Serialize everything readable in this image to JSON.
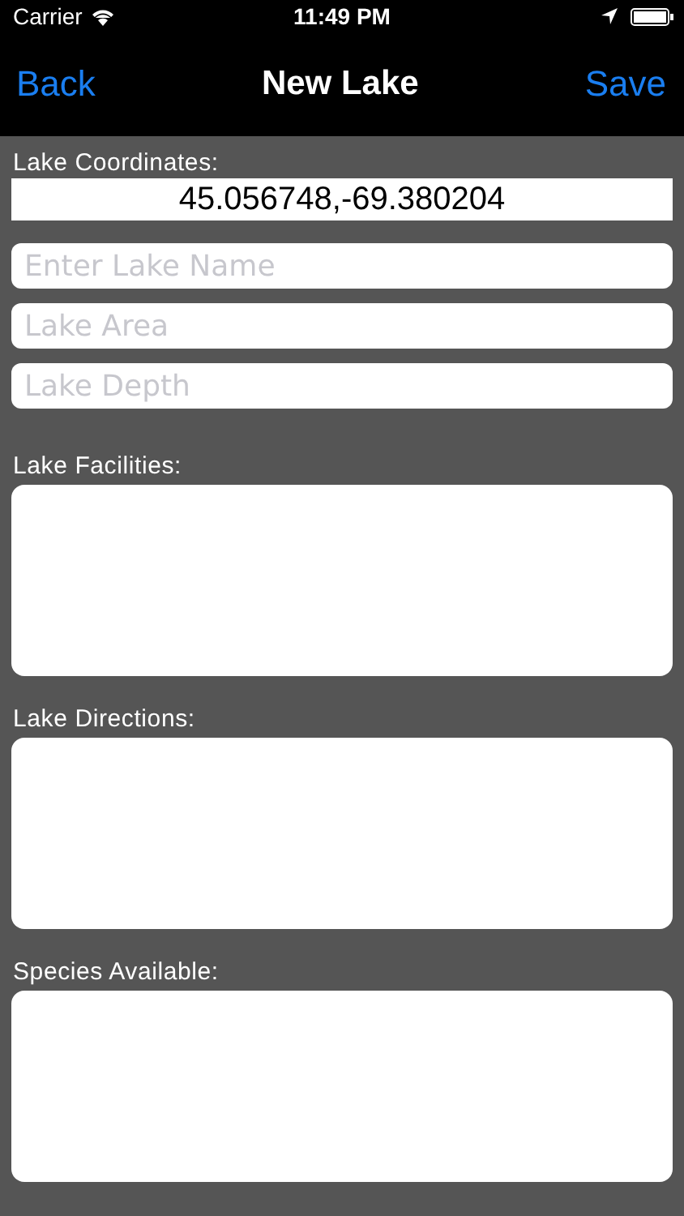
{
  "status_bar": {
    "carrier": "Carrier",
    "time": "11:49 PM"
  },
  "nav": {
    "back": "Back",
    "title": "New Lake",
    "save": "Save"
  },
  "fields": [
    {
      "kind": "coords",
      "label": "Lake Coordinates:",
      "value": "45.056748,-69.380204"
    },
    {
      "kind": "text",
      "placeholder": "Enter Lake Name"
    },
    {
      "kind": "text",
      "placeholder": "Lake Area"
    },
    {
      "kind": "text",
      "placeholder": "Lake Depth"
    },
    {
      "kind": "area",
      "label": "Lake Facilities:"
    },
    {
      "kind": "area",
      "label": "Lake Directions:"
    },
    {
      "kind": "area",
      "label": "Species Available:"
    }
  ]
}
